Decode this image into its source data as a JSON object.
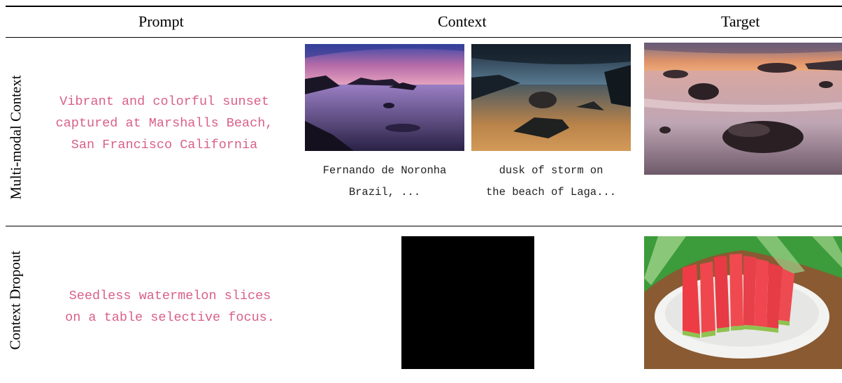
{
  "headers": {
    "prompt": "Prompt",
    "context": "Context",
    "target": "Target"
  },
  "rows": [
    {
      "label": "Multi-modal Context",
      "prompt": "Vibrant and colorful sunset\ncaptured at Marshalls Beach,\nSan Francisco California",
      "context_captions": [
        "Fernando de Noronha\nBrazil, ...",
        "dusk of storm on\nthe beach of Laga..."
      ],
      "images": [
        "purple-sunset-beach-rocks",
        "stormy-dusk-beach-rocks",
        "sunset-beach-waves-target"
      ]
    },
    {
      "label": "Context Dropout",
      "prompt": "Seedless watermelon slices\non a table selective focus.",
      "images": [
        "black-dropout-square",
        "watermelon-slices-plate-target"
      ]
    }
  ],
  "colors": {
    "prompt_text": "#d9608a",
    "rule": "#000000"
  }
}
